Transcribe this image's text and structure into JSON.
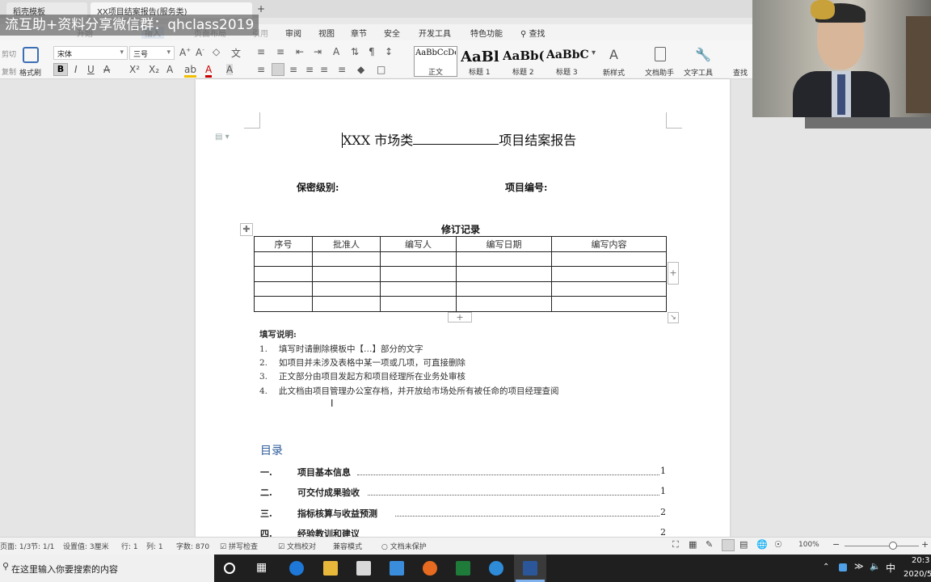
{
  "watermark": "流互助+资料分享微信群：qhclass2019",
  "tabs": [
    "稻壳模板",
    "XX项目结案报告(服务类)"
  ],
  "menu": [
    "开始",
    "插入",
    "页面布局",
    "引用",
    "审阅",
    "视图",
    "章节",
    "安全",
    "开发工具",
    "特色功能",
    "查找"
  ],
  "ribbon": {
    "cut": "剪切",
    "copy": "复制",
    "format_painter": "格式刷",
    "font_name": "宋体",
    "font_size": "三号",
    "styles": [
      {
        "sample": "AaBbCcDd",
        "label": "正文"
      },
      {
        "sample": "AaBl",
        "label": "标题 1"
      },
      {
        "sample": "AaBb(",
        "label": "标题 2"
      },
      {
        "sample": "AaBbC",
        "label": "标题 3"
      }
    ],
    "new_style": "新样式",
    "doc_assistant": "文档助手",
    "text_tools": "文字工具",
    "find_replace": "查找"
  },
  "document": {
    "title_prefix": "XXX 市场类",
    "title_suffix": "项目结案报告",
    "secrecy_label": "保密级别:",
    "project_no_label": "项目编号:",
    "revision_title": "修订记录",
    "revision_headers": [
      "序号",
      "批准人",
      "编写人",
      "编写日期",
      "编写内容"
    ],
    "instructions_title": "填写说明:",
    "instructions": [
      {
        "num": "1.",
        "text": "填写时请删除模板中【…】部分的文字"
      },
      {
        "num": "2.",
        "text": "如项目并未涉及表格中某一项或几项，可直接删除"
      },
      {
        "num": "3.",
        "text": "正文部分由项目发起方和项目经理所在业务处审核"
      },
      {
        "num": "4.",
        "text": "此文档由项目管理办公室存档，并开放给市场处所有被任命的项目经理查阅"
      }
    ],
    "toc_title": "目录",
    "toc": [
      {
        "num": "一.",
        "title": "项目基本信息",
        "page": "1"
      },
      {
        "num": "二.",
        "title": "可交付成果验收",
        "page": "1"
      },
      {
        "num": "三.",
        "title": "指标核算与收益预测",
        "page": "2"
      },
      {
        "num": "四.",
        "title": "经验教训和建议",
        "page": "2"
      }
    ]
  },
  "status": {
    "page": "页面: 1/3",
    "section": "节: 1/1",
    "setting": "设置值: 3厘米",
    "row": "行: 1",
    "col": "列: 1",
    "words": "字数: 870",
    "spell": "拼写检查",
    "proof": "文档校对",
    "compat": "兼容模式",
    "protect": "文档未保护",
    "zoom": "100%"
  },
  "taskbar": {
    "search_placeholder": "在这里输入你要搜索的内容",
    "ime": "中",
    "time": "20:3",
    "date": "2020/5"
  },
  "colors": {
    "toc_blue": "#2e5c9a",
    "word_blue": "#2b579a"
  }
}
